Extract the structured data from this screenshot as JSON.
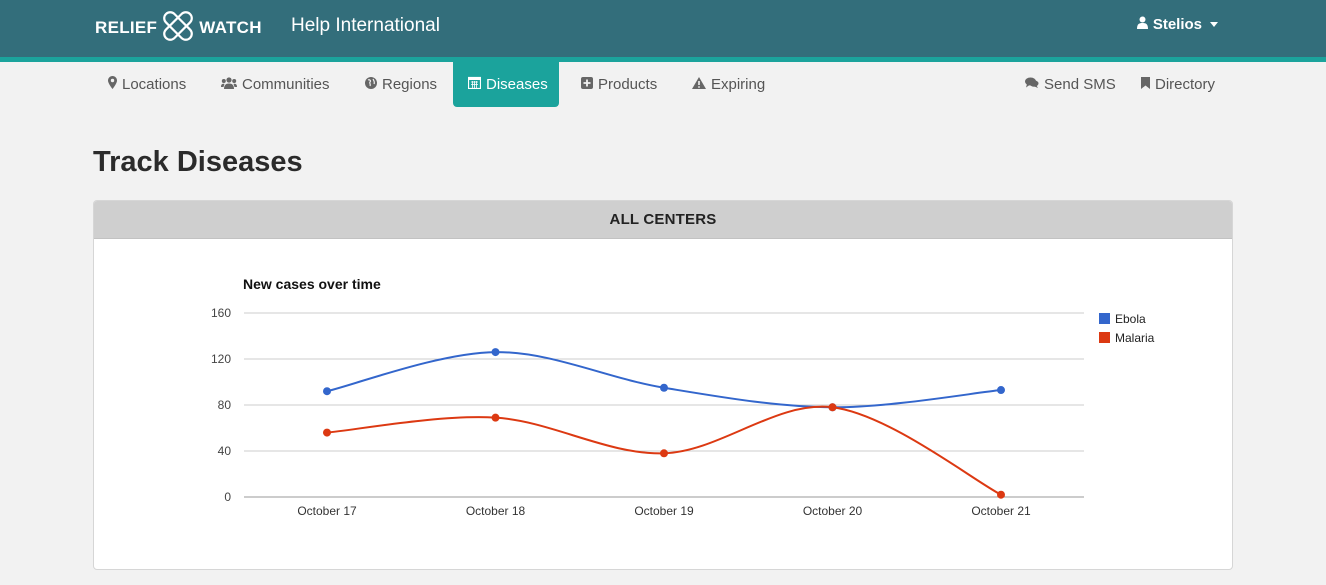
{
  "header": {
    "brand_left": "RELIEF",
    "brand_right": "WATCH",
    "org_name": "Help International",
    "user_name": "Stelios"
  },
  "nav": {
    "items": [
      {
        "label": "Locations",
        "icon": "map-marker-icon"
      },
      {
        "label": "Communities",
        "icon": "users-icon"
      },
      {
        "label": "Regions",
        "icon": "globe-icon"
      },
      {
        "label": "Diseases",
        "icon": "calendar-icon",
        "active": true
      },
      {
        "label": "Products",
        "icon": "plus-square-icon"
      },
      {
        "label": "Expiring",
        "icon": "warning-icon"
      }
    ],
    "right_items": [
      {
        "label": "Send SMS",
        "icon": "comments-icon"
      },
      {
        "label": "Directory",
        "icon": "bookmark-icon"
      }
    ]
  },
  "page": {
    "title": "Track Diseases",
    "panel_title": "ALL CENTERS"
  },
  "colors": {
    "topbar": "#336e7b",
    "accent": "#1ba39c",
    "ebola": "#3366cc",
    "malaria": "#dc3912"
  },
  "chart_data": {
    "type": "line",
    "title": "New cases over time",
    "xlabel": "",
    "ylabel": "",
    "categories": [
      "October 17",
      "October 18",
      "October 19",
      "October 20",
      "October 21"
    ],
    "series": [
      {
        "name": "Ebola",
        "values": [
          92,
          126,
          95,
          78,
          93
        ]
      },
      {
        "name": "Malaria",
        "values": [
          56,
          69,
          38,
          78,
          2
        ]
      }
    ],
    "ylim": [
      0,
      160
    ],
    "yticks": [
      0,
      40,
      80,
      120,
      160
    ],
    "grid": true,
    "legend": "right",
    "smooth": true
  }
}
